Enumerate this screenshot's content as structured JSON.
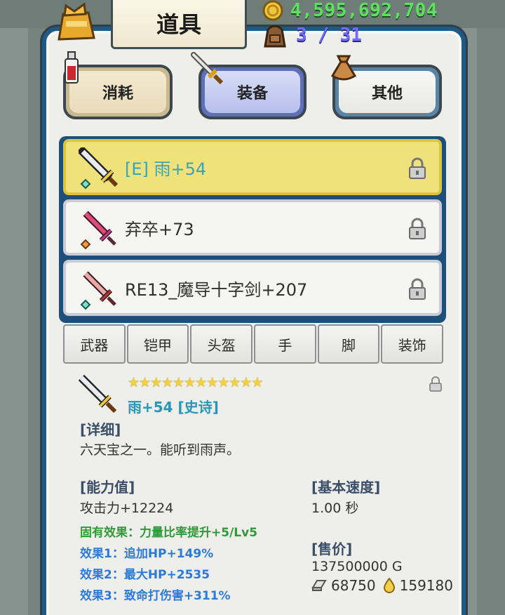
{
  "header": {
    "title": "道具",
    "gold": "4,595,692,704",
    "bag_capacity": "3 / 31"
  },
  "categories": [
    {
      "label": "消耗",
      "icon": "potion-icon",
      "selected": false
    },
    {
      "label": "装备",
      "icon": "sword-icon",
      "selected": true
    },
    {
      "label": "其他",
      "icon": "pouch-icon",
      "selected": false
    }
  ],
  "items": [
    {
      "name": "[E] 雨+54",
      "icon": "silver-sword-icon",
      "gem_color": "#7fe0c8",
      "selected": true
    },
    {
      "name": "弃卒+73",
      "icon": "red-sword-icon",
      "gem_color": "#f29a4a",
      "selected": false
    },
    {
      "name": "RE13_魔导十字剑+207",
      "icon": "crimson-sword-icon",
      "gem_color": "#7fe0c8",
      "selected": false
    }
  ],
  "tabs": [
    "武器",
    "铠甲",
    "头盔",
    "手",
    "脚",
    "装饰"
  ],
  "detail": {
    "stars": "★★★★★★★★★★★★",
    "name": "雨+54 [史诗]",
    "desc_title": "[详细]",
    "desc": "六天宝之一。能听到雨声。",
    "ability_title": "[能力值]",
    "attack": "攻击力+12224",
    "fixed_effect": "固有效果：力量比率提升+5/Lv5",
    "effect1": "效果1：追加HP+149%",
    "effect2": "效果2：最大HP+2535",
    "effect3": "效果3：致命打伤害+311%",
    "speed_title": "[基本速度]",
    "speed": "1.00 秒",
    "price_title": "[售价]",
    "price": "137500000 G",
    "silver_price": "68750",
    "drop_price": "159180"
  },
  "colors": {
    "panel_border": "#1e5a86",
    "gold_text": "#5fe060",
    "selected_row": "#efe27a",
    "green_effect": "#2e9a3a",
    "blue_effect": "#2d7ad6"
  }
}
